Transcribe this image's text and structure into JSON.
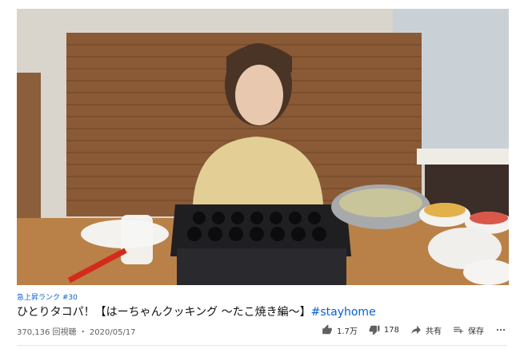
{
  "video": {
    "rank_badge": "急上昇ランク #30",
    "title": "ひとりタコパ！【はーちゃんクッキング 〜たこ焼き編〜】",
    "hashtag": "#stayhome",
    "views": "370,136 回視聴",
    "date": "2020/05/17"
  },
  "actions": {
    "like_count": "1.7万",
    "dislike_count": "178",
    "share_label": "共有",
    "save_label": "保存"
  },
  "icons": [
    "thumbs-up-icon",
    "thumbs-down-icon",
    "share-icon",
    "playlist-add-icon",
    "more-icon"
  ],
  "colors": {
    "link": "#065fd4",
    "secondary_text": "#606060"
  }
}
